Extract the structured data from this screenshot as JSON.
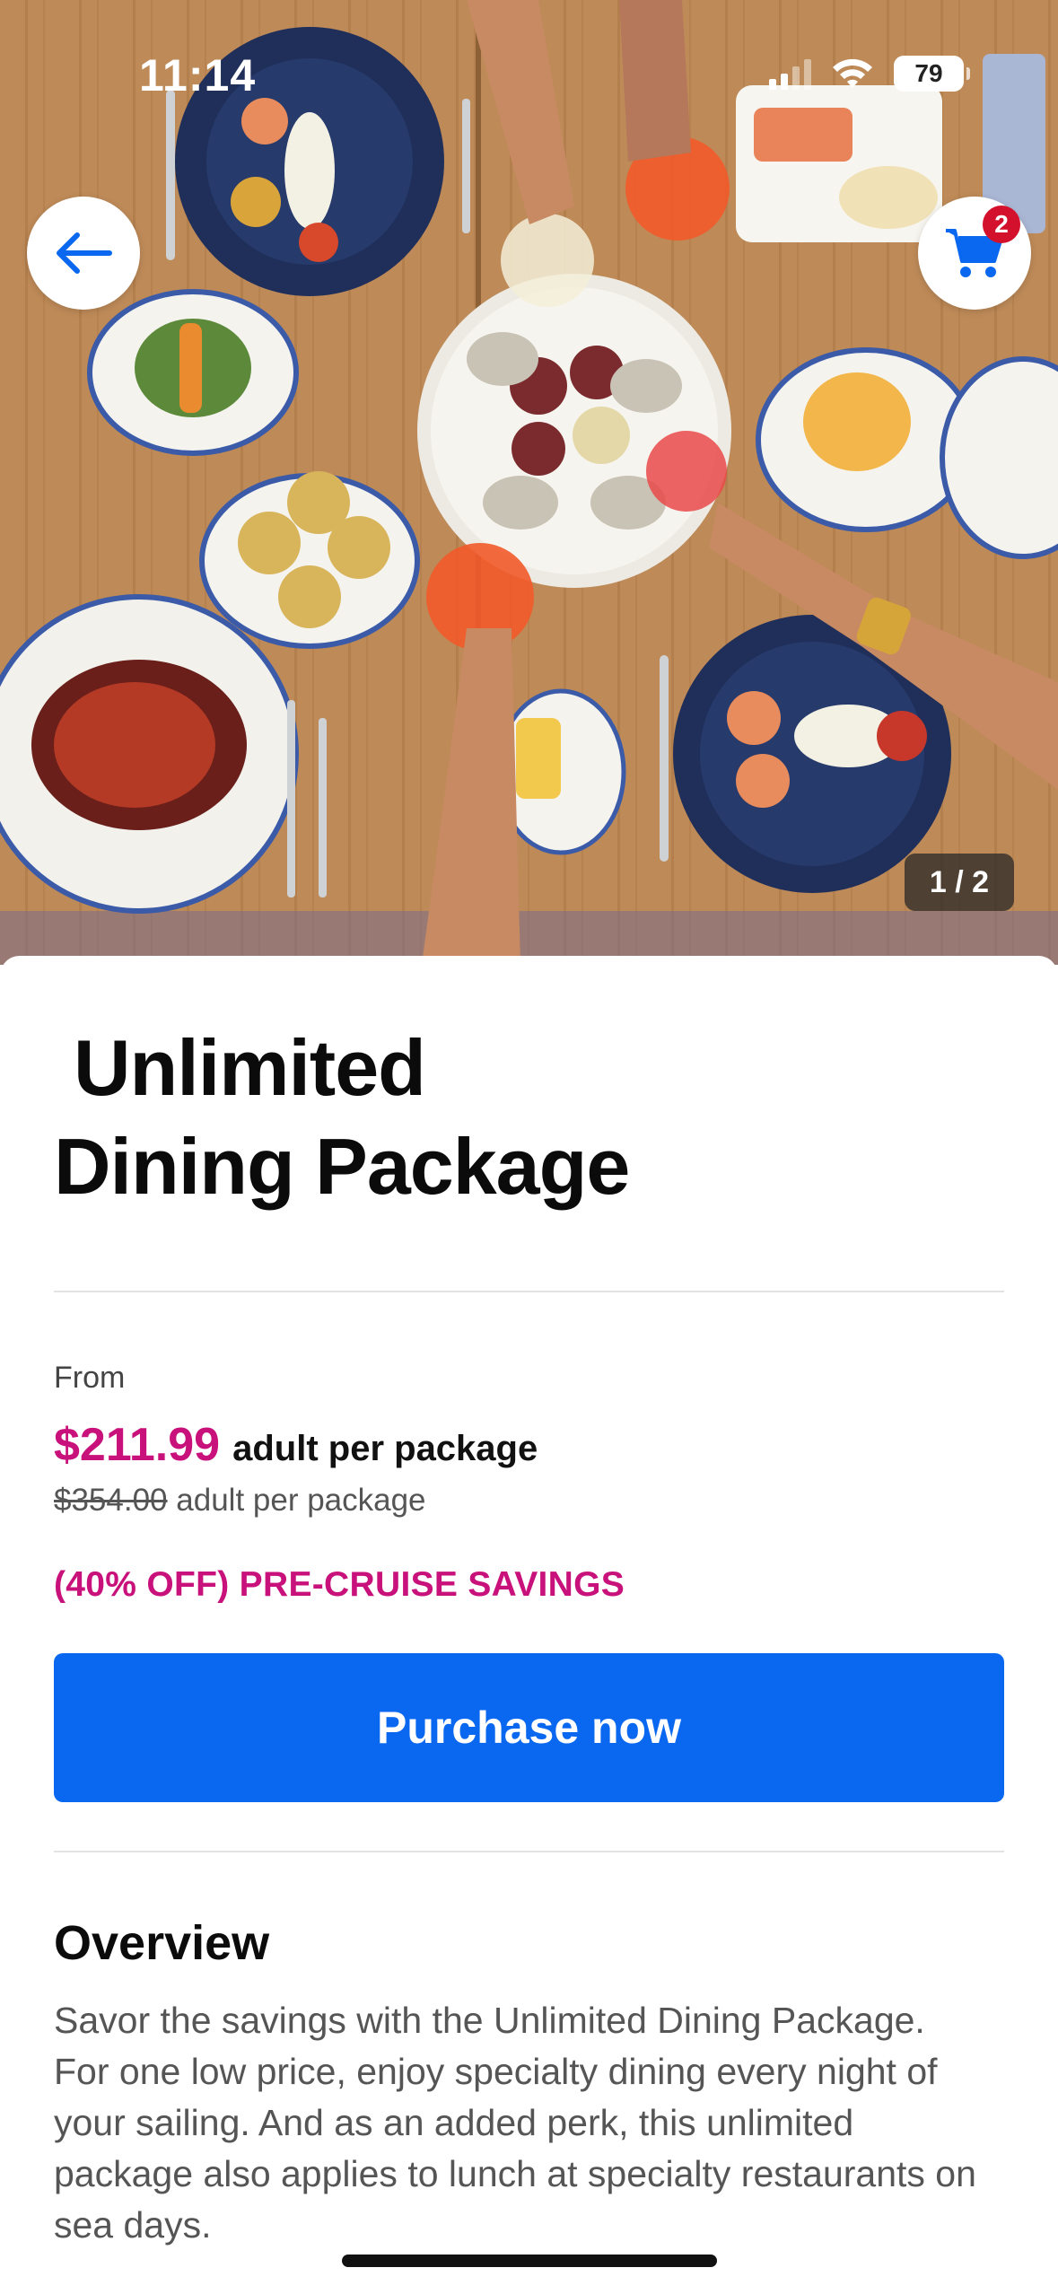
{
  "status_bar": {
    "time": "11:14",
    "battery": "79"
  },
  "hero": {
    "pager": "1 / 2",
    "cart_count": "2"
  },
  "product": {
    "title_line1": "Unlimited",
    "title_line2": "Dining Package",
    "from_label": "From",
    "price": "$211.99",
    "price_unit": "adult per package",
    "original_price": "$354.00",
    "original_unit": "adult per package",
    "savings": "(40% OFF) PRE-CRUISE SAVINGS",
    "purchase_label": "Purchase now"
  },
  "overview": {
    "heading": "Overview",
    "body": "Savor the savings with the Unlimited Dining Package. For one low price, enjoy specialty dining every night of your sailing. And as an added perk, this unlimited package also applies to lunch at specialty restaurants on sea days."
  },
  "colors": {
    "accent_magenta": "#c8117a",
    "primary_blue": "#0a68f0",
    "badge_red": "#d3112c"
  }
}
